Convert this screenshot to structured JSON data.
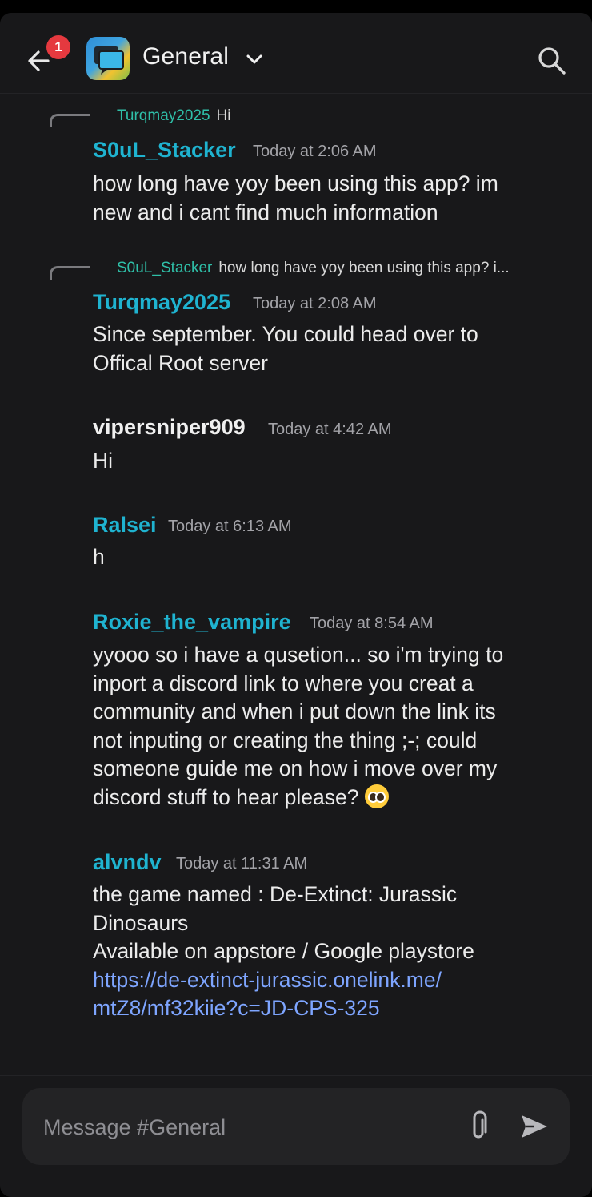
{
  "header": {
    "badge_count": "1",
    "channel_title": "General"
  },
  "messages": [
    {
      "reply": {
        "user": "Turqmay2025",
        "text": "Hi"
      },
      "user": "S0uL_Stacker",
      "time": "Today at 2:06 AM",
      "lines": [
        "how long have yoy been using this app? im",
        "new and i cant find much information"
      ]
    },
    {
      "reply": {
        "user": "S0uL_Stacker",
        "text": "how long have yoy been using this app? i..."
      },
      "user": "Turqmay2025",
      "time": "Today at 2:08 AM",
      "lines": [
        "Since september. You could head over to",
        "Offical Root server"
      ]
    },
    {
      "user": "vipersniper909",
      "time": "Today at 4:42 AM",
      "lines": [
        "Hi"
      ]
    },
    {
      "user": "Ralsei",
      "time": "Today at 6:13 AM",
      "lines": [
        "h"
      ]
    },
    {
      "user": "Roxie_the_vampire",
      "time": "Today at 8:54 AM",
      "lines": [
        "yyooo so i have a qusetion... so i'm trying to",
        "inport a discord link to where you creat a",
        "community and when i put down the link its",
        "not inputing or creating the thing ;-; could",
        "someone guide me on how i move over my",
        "discord stuff to hear please?"
      ]
    },
    {
      "user": "alvndv",
      "time": "Today at 11:31 AM",
      "lines": [
        "the game named : De-Extinct: Jurassic",
        "Dinosaurs",
        "Available on appstore / Google playstore"
      ],
      "link_lines": [
        "https://de-extinct-jurassic.onelink.me/",
        "mtZ8/mf32kiie?c=JD-CPS-325"
      ]
    }
  ],
  "composer": {
    "placeholder": "Message #General"
  },
  "icons": [
    "back-arrow-icon",
    "app-icon",
    "chevron-down-icon",
    "search-icon",
    "reply-line-icon",
    "pleading-face-emoji",
    "paperclip-icon",
    "send-icon"
  ]
}
